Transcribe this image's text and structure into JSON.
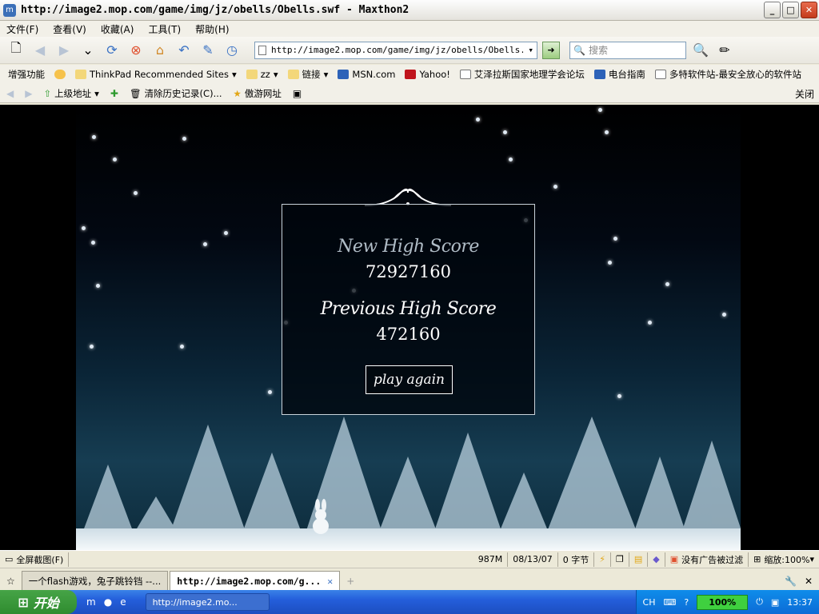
{
  "titlebar": {
    "title": "http://image2.mop.com/game/img/jz/obells/Obells.swf - Maxthon2"
  },
  "window_buttons": {
    "minimize": "_",
    "maximize": "□",
    "close": "✕"
  },
  "menu": [
    "文件(F)",
    "查看(V)",
    "收藏(A)",
    "工具(T)",
    "帮助(H)"
  ],
  "address": {
    "value": "http://image2.mop.com/game/img/jz/obells/Obells.swf"
  },
  "search": {
    "placeholder": "搜索"
  },
  "favorites": [
    {
      "label": "增强功能",
      "color": "#f2f0e8"
    },
    {
      "label": "",
      "color": "#f6c24b"
    },
    {
      "label": "ThinkPad Recommended Sites",
      "color": "#f3d77a"
    },
    {
      "label": "zz",
      "color": "#f3d77a"
    },
    {
      "label": "链接",
      "color": "#f3d77a"
    },
    {
      "label": "MSN.com",
      "color": "#2d62b8"
    },
    {
      "label": "Yahoo!",
      "color": "#c0141c"
    },
    {
      "label": "艾泽拉斯国家地理学会论坛",
      "color": "#ffffff"
    },
    {
      "label": "电台指南",
      "color": "#2d62b8"
    },
    {
      "label": "多特软件站-最安全放心的软件站",
      "color": "#ffffff"
    }
  ],
  "navbar": {
    "up_label": "上级地址",
    "clear_label": "清除历史记录(C)...",
    "site_label": "傲游网址",
    "close_label": "关闭"
  },
  "game": {
    "title_new": "New High Score",
    "new_score": "72927160",
    "title_prev": "Previous High Score",
    "prev_score": "472160",
    "button_label": "play again"
  },
  "status": {
    "screenshot_label": "全屏截图(F)",
    "memory": "987M",
    "date": "08/13/07",
    "bytes": "0 字节",
    "ad_filter": "没有广告被过滤",
    "zoom": "缩放:100%"
  },
  "tabs": [
    {
      "label": "一个flash游戏，兔子跳铃铛 --..."
    },
    {
      "label": "http://image2.mop.com/g..."
    }
  ],
  "taskbar": {
    "start_label": "开始",
    "task_label": "http://image2.mo...",
    "lang": "CH",
    "battery": "100%",
    "clock": "13:37"
  }
}
